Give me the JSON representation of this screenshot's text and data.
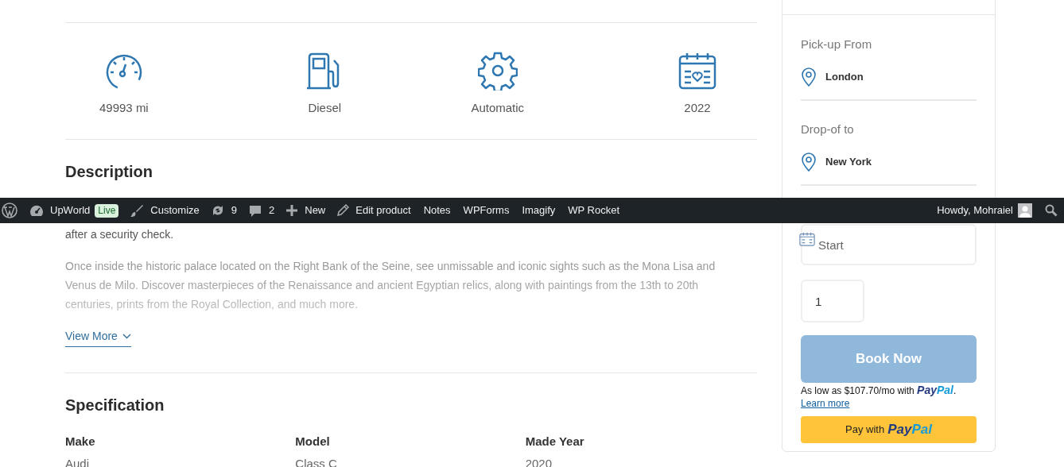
{
  "specs_row": [
    {
      "kind": "odometer",
      "label": "49993 mi"
    },
    {
      "kind": "fuel",
      "label": "Diesel"
    },
    {
      "kind": "gear",
      "label": "Automatic"
    },
    {
      "kind": "calendar",
      "label": "2022"
    }
  ],
  "description": {
    "heading": "Description",
    "visible_text": "after a security check.",
    "paragraph": "Once inside the historic palace located on the Right Bank of the Seine, see unmissable and iconic sights such as the Mona Lisa and Venus de Milo. Discover masterpieces of the Renaissance and ancient Egyptian relics, along with paintings from the 13th to 20th centuries, prints from the Royal Collection, and much more.",
    "link": "View More"
  },
  "specification": {
    "heading": "Specification",
    "fields": [
      {
        "label": "Make",
        "value": "Audi"
      },
      {
        "label": "Model",
        "value": "Class C"
      },
      {
        "label": "Made Year",
        "value": "2020"
      }
    ]
  },
  "booking": {
    "locations": [
      {
        "label": "Pick-up From",
        "value": "London"
      },
      {
        "label": "Drop-of to",
        "value": "New York"
      }
    ],
    "start_placeholder": "Start",
    "quantity": "1",
    "book_button": "Book Now",
    "paypal_message": {
      "prefix": "As low as $107.70/mo with",
      "logo": [
        "Pay",
        "Pal"
      ],
      "suffix": ".",
      "link": "Learn more"
    },
    "paypal_button": {
      "prefix": "Pay with",
      "logo": [
        "Pay",
        "Pal"
      ]
    }
  },
  "admin_bar": {
    "items": [
      {
        "kind": "wp-logo"
      },
      {
        "kind": "site",
        "label": "UpWorld",
        "badge": "Live"
      },
      {
        "kind": "customize",
        "label": "Customize"
      },
      {
        "kind": "updates",
        "label": "9"
      },
      {
        "kind": "comments",
        "label": "2"
      },
      {
        "kind": "new",
        "label": "New"
      },
      {
        "kind": "edit",
        "label": "Edit product"
      },
      {
        "kind": "plain",
        "label": "Notes"
      },
      {
        "kind": "plain",
        "label": "WPForms"
      },
      {
        "kind": "plain",
        "label": "Imagify"
      },
      {
        "kind": "plain",
        "label": "WP Rocket"
      }
    ],
    "greeting": "Howdy, Mohraiel"
  }
}
